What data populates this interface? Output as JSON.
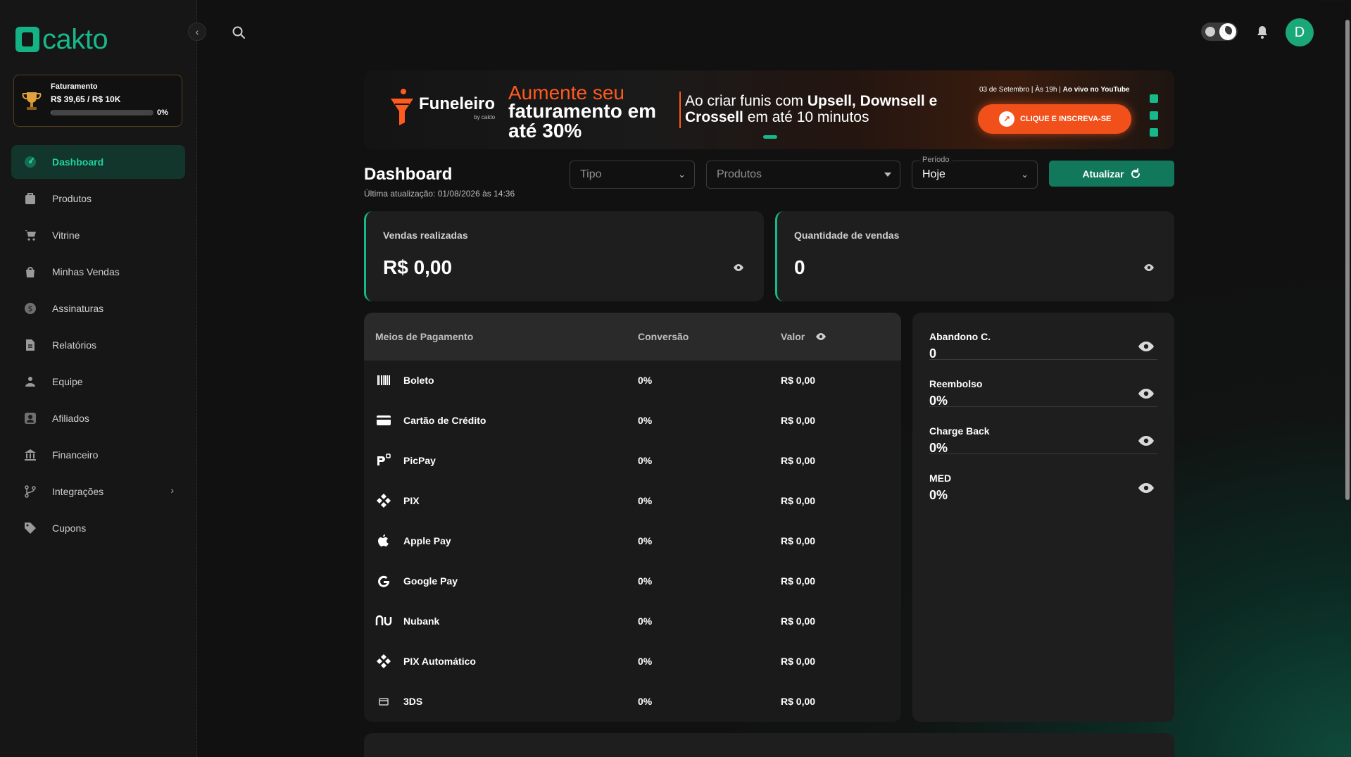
{
  "brand": {
    "name": "cakto"
  },
  "billing": {
    "label": "Faturamento",
    "value": "R$ 39,65 / R$ 10K",
    "progress": 0.004,
    "percent": "0%"
  },
  "nav": [
    {
      "label": "Dashboard",
      "icon": "dashboard-icon",
      "active": true
    },
    {
      "label": "Produtos",
      "icon": "box-icon"
    },
    {
      "label": "Vitrine",
      "icon": "cart-icon"
    },
    {
      "label": "Minhas Vendas",
      "icon": "bag-icon"
    },
    {
      "label": "Assinaturas",
      "icon": "dollar-icon"
    },
    {
      "label": "Relatórios",
      "icon": "report-icon"
    },
    {
      "label": "Equipe",
      "icon": "team-icon"
    },
    {
      "label": "Afiliados",
      "icon": "user-icon"
    },
    {
      "label": "Financeiro",
      "icon": "bank-icon"
    },
    {
      "label": "Integrações",
      "icon": "branch-icon",
      "chevron": true
    },
    {
      "label": "Cupons",
      "icon": "tag-icon"
    }
  ],
  "avatar": {
    "initial": "D"
  },
  "banner": {
    "brand": "Funeleiro",
    "brand_sub": "by cakto",
    "headline_1": "Aumente seu",
    "headline_2": "faturamento em até 30%",
    "text_1": "Ao criar funis com ",
    "text_bold": "Upsell, Downsell e Crossell",
    "text_2": " em até 10 minutos",
    "date": "03 de Setembro | Às 19h | ",
    "date_bold": "Ao vivo no YouTube",
    "cta": "CLIQUE E INSCREVA-SE"
  },
  "dashboard": {
    "title": "Dashboard",
    "updated": "Última atualização: 01/08/2026 às 14:36",
    "filters": {
      "tipo": "Tipo",
      "produtos": "Produtos",
      "periodo_label": "Período",
      "periodo_value": "Hoje"
    },
    "refresh": "Atualizar"
  },
  "stats": [
    {
      "label": "Vendas realizadas",
      "value": "R$ 0,00"
    },
    {
      "label": "Quantidade de vendas",
      "value": "0"
    }
  ],
  "payments": {
    "headers": [
      "Meios de Pagamento",
      "Conversão",
      "Valor"
    ],
    "rows": [
      {
        "name": "Boleto",
        "icon": "barcode-icon",
        "conversion": "0%",
        "value": "R$ 0,00"
      },
      {
        "name": "Cartão de Crédito",
        "icon": "credit-card-icon",
        "conversion": "0%",
        "value": "R$ 0,00"
      },
      {
        "name": "PicPay",
        "icon": "picpay-icon",
        "conversion": "0%",
        "value": "R$ 0,00"
      },
      {
        "name": "PIX",
        "icon": "pix-icon",
        "conversion": "0%",
        "value": "R$ 0,00"
      },
      {
        "name": "Apple Pay",
        "icon": "apple-icon",
        "conversion": "0%",
        "value": "R$ 0,00"
      },
      {
        "name": "Google Pay",
        "icon": "google-icon",
        "conversion": "0%",
        "value": "R$ 0,00"
      },
      {
        "name": "Nubank",
        "icon": "nubank-icon",
        "conversion": "0%",
        "value": "R$ 0,00"
      },
      {
        "name": "PIX Automático",
        "icon": "pix-icon",
        "conversion": "0%",
        "value": "R$ 0,00"
      },
      {
        "name": "3DS",
        "icon": "card-small-icon",
        "conversion": "0%",
        "value": "R$ 0,00"
      }
    ]
  },
  "metrics": [
    {
      "label": "Abandono C.",
      "value": "0"
    },
    {
      "label": "Reembolso",
      "value": "0%"
    },
    {
      "label": "Charge Back",
      "value": "0%"
    },
    {
      "label": "MED",
      "value": "0%"
    }
  ],
  "colors": {
    "accent": "#17b889",
    "banner_orange": "#f1501a",
    "card_bg": "#1e1e1e"
  }
}
